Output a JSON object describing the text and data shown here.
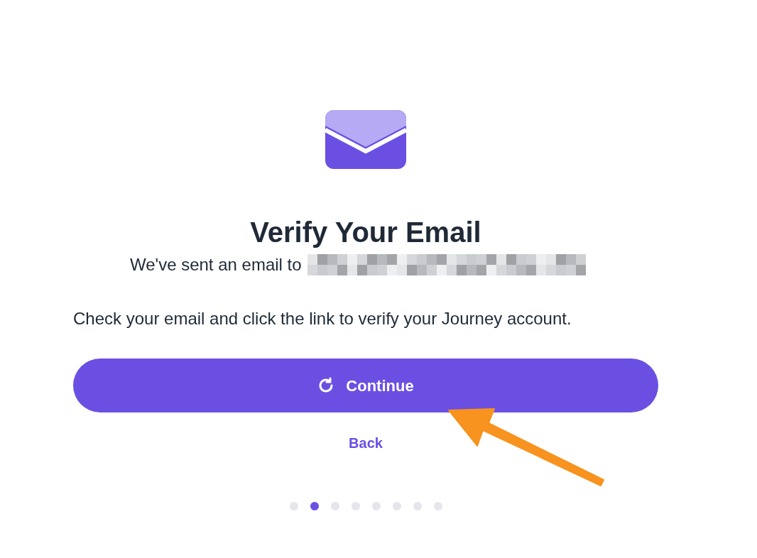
{
  "title": "Verify Your Email",
  "sent_line": {
    "text": "We've sent an email to",
    "email_redacted": true
  },
  "instructions": "Check your email and click the link to verify your Journey account.",
  "primary_button": {
    "label": "Continue"
  },
  "back_link": "Back",
  "steps": [
    {
      "selected": false
    },
    {
      "selected": true
    },
    {
      "selected": false
    },
    {
      "selected": false
    },
    {
      "selected": false
    },
    {
      "selected": false
    },
    {
      "selected": false
    },
    {
      "selected": false
    }
  ]
}
